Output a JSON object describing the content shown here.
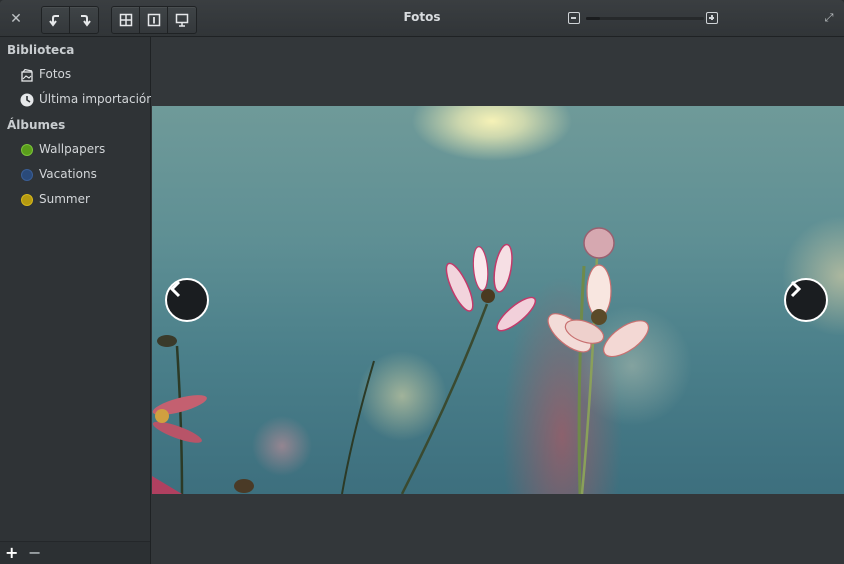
{
  "header": {
    "title": "Fotos",
    "zoom_level": 0.12
  },
  "sidebar": {
    "library_header": "Biblioteca",
    "library_items": [
      {
        "label": "Fotos",
        "icon": "photos-icon"
      },
      {
        "label": "Última importación",
        "icon": "clock-icon"
      }
    ],
    "albums_header": "Álbumes",
    "albums": [
      {
        "label": "Wallpapers",
        "color": "#5a9e1b"
      },
      {
        "label": "Vacations",
        "color": "#2a4a7a"
      },
      {
        "label": "Summer",
        "color": "#b59a10"
      }
    ]
  },
  "colors": {
    "accent_green": "#5a9e1b",
    "accent_blue": "#2a4a7a",
    "accent_yellow": "#b59a10"
  }
}
